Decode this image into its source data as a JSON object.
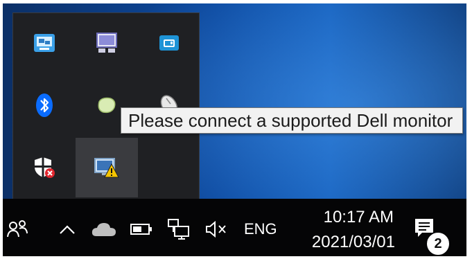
{
  "tooltip": {
    "text": "Please connect a supported Dell monitor"
  },
  "overflow": {
    "icons": [
      "network-manager-icon",
      "display-settings-icon",
      "card-reader-icon",
      "bluetooth-icon",
      "green-app-icon",
      "mouse-icon",
      "security-warning-shield-icon",
      "dell-display-manager-warning-icon"
    ]
  },
  "taskbar": {
    "language": "ENG",
    "time": "10:17 AM",
    "date": "2021/03/01",
    "notification_count": "2"
  },
  "colors": {
    "flyout_bg": "#1f2023",
    "taskbar_bg": "#050506",
    "warning_yellow": "#f5c400",
    "bluetooth_blue": "#0a6cff"
  }
}
